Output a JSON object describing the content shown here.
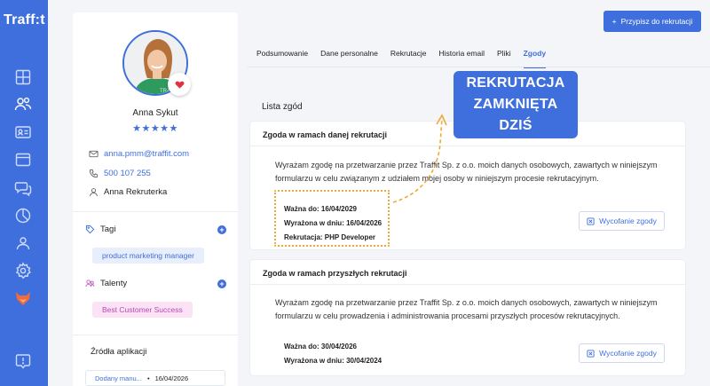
{
  "app": {
    "logo": "Traff:t"
  },
  "nav": {
    "items": [
      "dashboard-icon",
      "users-icon",
      "contact-card-icon",
      "window-icon",
      "chat-icon",
      "chart-icon",
      "team-icon",
      "settings-icon",
      "fox-icon",
      "help-icon"
    ]
  },
  "colors": {
    "brand": "#3f6fdc",
    "highlight": "#f0a838",
    "heart": "#e0323c",
    "talent_chip": "#fbe3f5"
  },
  "candidate": {
    "name": "Anna Sykut",
    "rating_stars": "★★★★★",
    "email": "anna.pmm@traffit.com",
    "phone": "500 107 255",
    "owner": "Anna Rekruterka"
  },
  "tags": {
    "title": "Tagi",
    "items": [
      "product marketing manager"
    ]
  },
  "talents": {
    "title": "Talenty",
    "items": [
      "Best Customer Success"
    ]
  },
  "sources": {
    "title": "Źródła aplikacji",
    "item_label": "Dodany manu...",
    "item_sep": "•",
    "item_date": "16/04/2026"
  },
  "header": {
    "assign_button": "Przypisz do rekrutacji"
  },
  "tabs": [
    {
      "label": "Podsumowanie"
    },
    {
      "label": "Dane personalne"
    },
    {
      "label": "Rekrutacje"
    },
    {
      "label": "Historia email"
    },
    {
      "label": "Pliki"
    },
    {
      "label": "Zgody"
    }
  ],
  "consents": {
    "list_title": "Lista zgód",
    "items": [
      {
        "title": "Zgoda w ramach danej rekrutacji",
        "body": "Wyrażam zgodę na przetwarzanie przez Traffit Sp. z o.o. moich danych osobowych, zawartych w niniejszym formularzu w celu związanym z udziałem mojej osoby w niniejszym procesie rekrutacyjnym.",
        "valid_to": "Ważna do: 16/04/2029",
        "given_on": "Wyrażona w dniu: 16/04/2026",
        "recruitment": "Rekrutacja:  PHP Developer",
        "withdraw": "Wycofanie zgody"
      },
      {
        "title": "Zgoda w ramach przyszłych rekrutacji",
        "body": "Wyrażam zgodę na przetwarzanie przez Traffit Sp. z o.o. moich danych osobowych, zawartych w niniejszym formularzu w celu prowadzenia i administrowania procesami przyszłych procesów rekrutacyjnych.",
        "valid_to": "Ważna do: 30/04/2026",
        "given_on": "Wyrażona w dniu: 30/04/2024",
        "withdraw": "Wycofanie zgody"
      }
    ]
  },
  "annotation": {
    "line1": "REKRUTACJA",
    "line2": "ZAMKNIĘTA DZIŚ"
  }
}
